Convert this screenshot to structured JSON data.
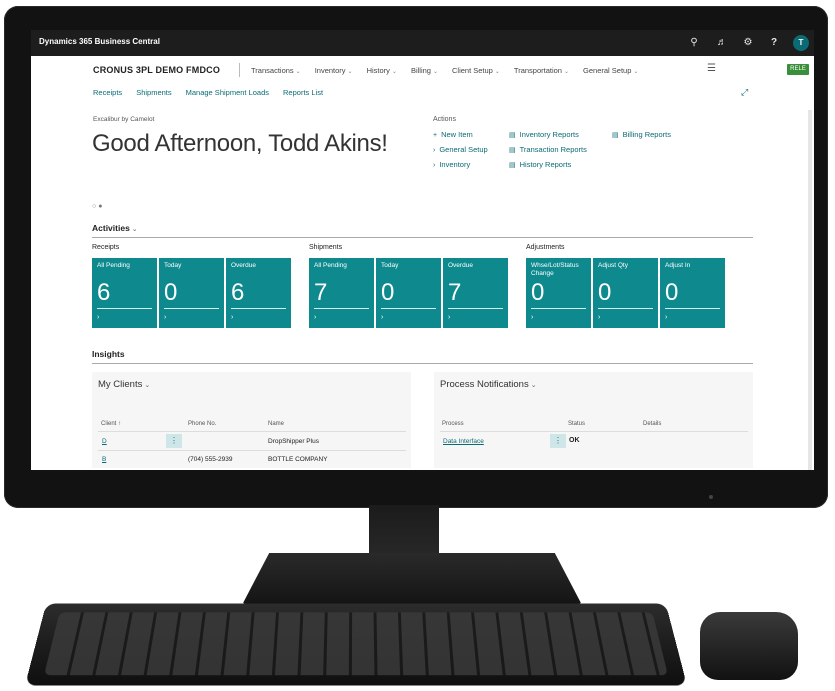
{
  "header": {
    "app_title": "Dynamics 365 Business Central",
    "avatar_initial": "T",
    "env_badge": "RELE"
  },
  "nav": {
    "company": "CRONUS 3PL DEMO FMDCO",
    "menu": [
      "Transactions",
      "Inventory",
      "History",
      "Billing",
      "Client Setup",
      "Transportation",
      "General Setup"
    ],
    "subnav": [
      "Receipts",
      "Shipments",
      "Manage Shipment Loads",
      "Reports List"
    ]
  },
  "headline": {
    "subtitle": "Excalibur by Camelot",
    "greeting": "Good Afternoon, Todd Akins!"
  },
  "actions": {
    "title": "Actions",
    "items": [
      "New Item",
      "General Setup",
      "Inventory",
      "Inventory Reports",
      "Transaction Reports",
      "History Reports",
      "Billing Reports"
    ]
  },
  "activities": {
    "title": "Activities",
    "groups": [
      {
        "title": "Receipts",
        "tiles": [
          {
            "label": "All Pending",
            "value": "6"
          },
          {
            "label": "Today",
            "value": "0"
          },
          {
            "label": "Overdue",
            "value": "6"
          }
        ]
      },
      {
        "title": "Shipments",
        "tiles": [
          {
            "label": "All Pending",
            "value": "7"
          },
          {
            "label": "Today",
            "value": "0"
          },
          {
            "label": "Overdue",
            "value": "7"
          }
        ]
      },
      {
        "title": "Adjustments",
        "tiles": [
          {
            "label": "Whse/Lot/Status Change",
            "value": "0"
          },
          {
            "label": "Adjust Qty",
            "value": "0"
          },
          {
            "label": "Adjust In",
            "value": "0"
          }
        ]
      }
    ]
  },
  "insights": {
    "title": "Insights",
    "my_clients": {
      "title": "My Clients",
      "columns": [
        "Client ↑",
        "Phone No.",
        "Name"
      ],
      "rows": [
        {
          "client": "D",
          "phone": "",
          "name": "DropShipper Plus"
        },
        {
          "client": "B",
          "phone": "(704) 555-2939",
          "name": "BOTTLE COMPANY"
        }
      ]
    },
    "process_notifications": {
      "title": "Process Notifications",
      "columns": [
        "Process",
        "Status",
        "Details"
      ],
      "rows": [
        {
          "process": "Data Interface",
          "status": "OK",
          "details": ""
        }
      ]
    }
  },
  "colors": {
    "accent": "#0e8a8f",
    "link": "#0a6b74",
    "topbar": "#1d1d1d"
  }
}
